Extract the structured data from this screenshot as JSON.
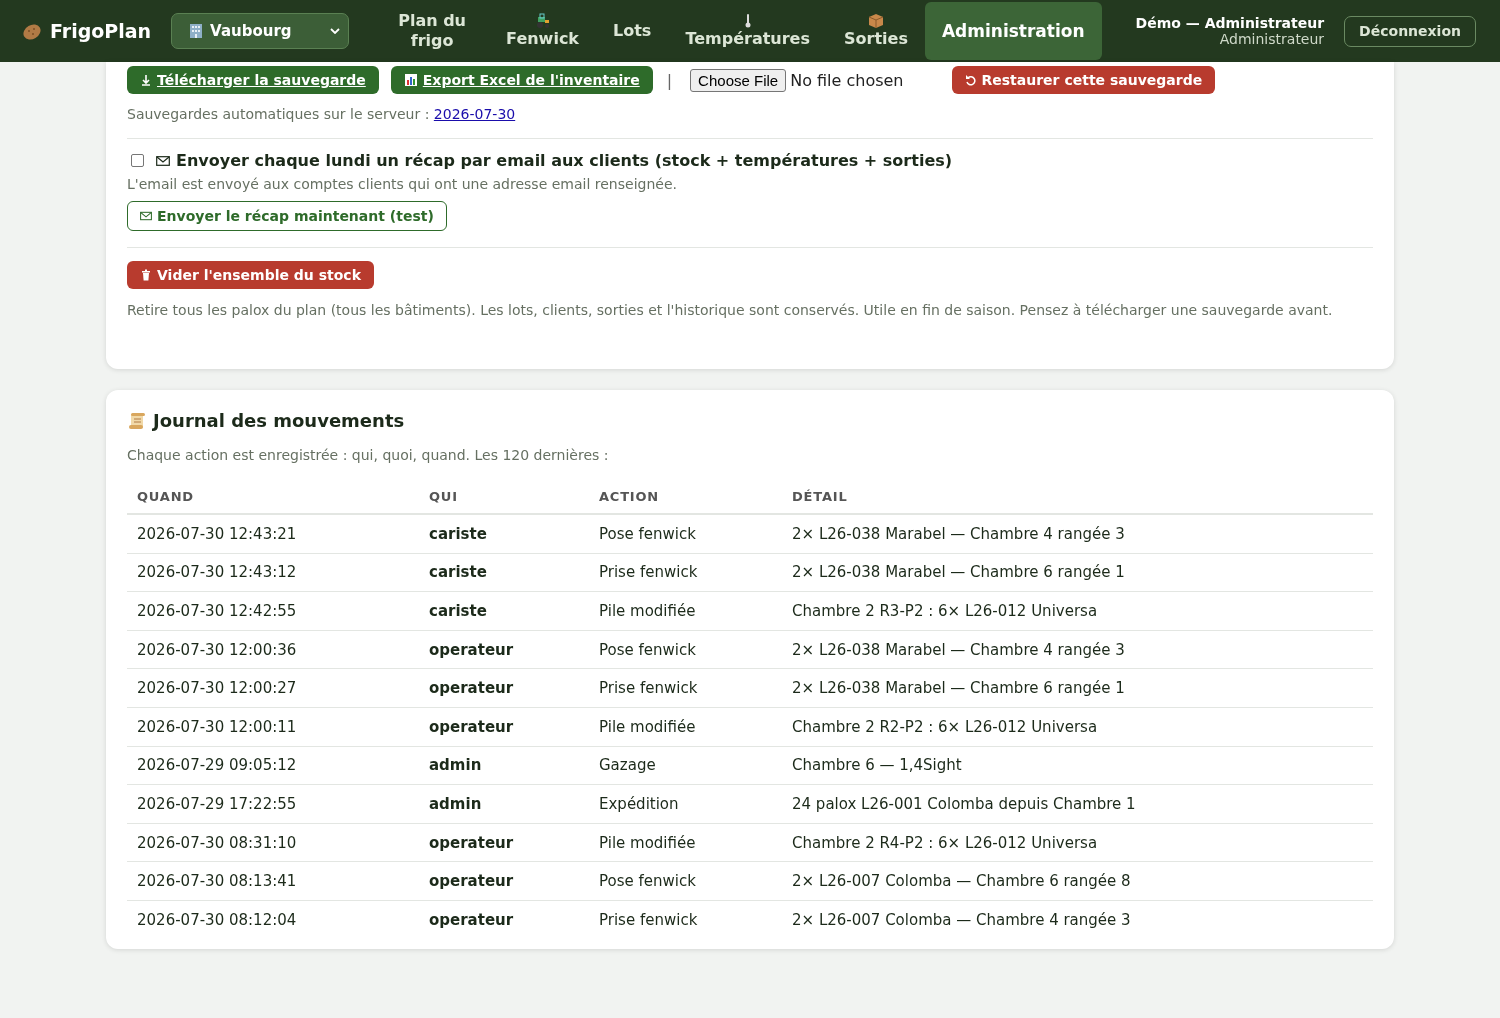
{
  "header": {
    "brand": "FrigoPlan",
    "site_select": {
      "value": "Vaubourg"
    },
    "nav": [
      {
        "label": "Plan du frigo",
        "kind": "text",
        "selected": false
      },
      {
        "label": "Fenwick",
        "kind": "tractor",
        "selected": false
      },
      {
        "label": "Lots",
        "kind": "text",
        "selected": false
      },
      {
        "label": "Températures",
        "kind": "thermometer",
        "selected": false
      },
      {
        "label": "Sorties",
        "kind": "box",
        "selected": false
      },
      {
        "label": "Administration",
        "kind": "text",
        "selected": true
      }
    ],
    "user": {
      "name": "Démo — Administrateur",
      "role": "Administrateur"
    },
    "logout": "Déconnexion"
  },
  "backup": {
    "download": "Télécharger la sauvegarde",
    "export": "Export Excel de l'inventaire",
    "separator": "|",
    "file_button": "Choose File",
    "file_status": "No file chosen",
    "restore": "Restaurer cette sauvegarde",
    "auto_label": "Sauvegardes automatiques sur le serveur :",
    "auto_link": "2026-07-30"
  },
  "recap": {
    "checked": false,
    "label": "Envoyer chaque lundi un récap par email aux clients (stock + températures + sorties)",
    "hint": "L'email est envoyé aux comptes clients qui ont une adresse email renseignée.",
    "test_button": "Envoyer le récap maintenant (test)"
  },
  "clear": {
    "button": "Vider l'ensemble du stock",
    "hint": "Retire tous les palox du plan (tous les bâtiments). Les lots, clients, sorties et l'historique sont conservés. Utile en fin de saison. Pensez à télécharger une sauvegarde avant."
  },
  "journal": {
    "title": "Journal des mouvements",
    "subtitle": "Chaque action est enregistrée : qui, quoi, quand. Les 120 dernières :",
    "columns": [
      "QUAND",
      "QUI",
      "ACTION",
      "DÉTAIL"
    ],
    "rows": [
      [
        "2026-07-30 12:43:21",
        "cariste",
        "Pose fenwick",
        "2× L26-038 Marabel — Chambre 4 rangée 3"
      ],
      [
        "2026-07-30 12:43:12",
        "cariste",
        "Prise fenwick",
        "2× L26-038 Marabel — Chambre 6 rangée 1"
      ],
      [
        "2026-07-30 12:42:55",
        "cariste",
        "Pile modifiée",
        "Chambre 2 R3-P2 : 6× L26-012 Universa"
      ],
      [
        "2026-07-30 12:00:36",
        "operateur",
        "Pose fenwick",
        "2× L26-038 Marabel — Chambre 4 rangée 3"
      ],
      [
        "2026-07-30 12:00:27",
        "operateur",
        "Prise fenwick",
        "2× L26-038 Marabel — Chambre 6 rangée 1"
      ],
      [
        "2026-07-30 12:00:11",
        "operateur",
        "Pile modifiée",
        "Chambre 2 R2-P2 : 6× L26-012 Universa"
      ],
      [
        "2026-07-29 09:05:12",
        "admin",
        "Gazage",
        "Chambre 6 — 1,4Sight"
      ],
      [
        "2026-07-29 17:22:55",
        "admin",
        "Expédition",
        "24 palox L26-001 Colomba depuis Chambre 1"
      ],
      [
        "2026-07-30 08:31:10",
        "operateur",
        "Pile modifiée",
        "Chambre 2 R4-P2 : 6× L26-012 Universa"
      ],
      [
        "2026-07-30 08:13:41",
        "operateur",
        "Pose fenwick",
        "2× L26-007 Colomba — Chambre 6 rangée 8"
      ],
      [
        "2026-07-30 08:12:04",
        "operateur",
        "Prise fenwick",
        "2× L26-007 Colomba — Chambre 4 rangée 3"
      ]
    ]
  }
}
